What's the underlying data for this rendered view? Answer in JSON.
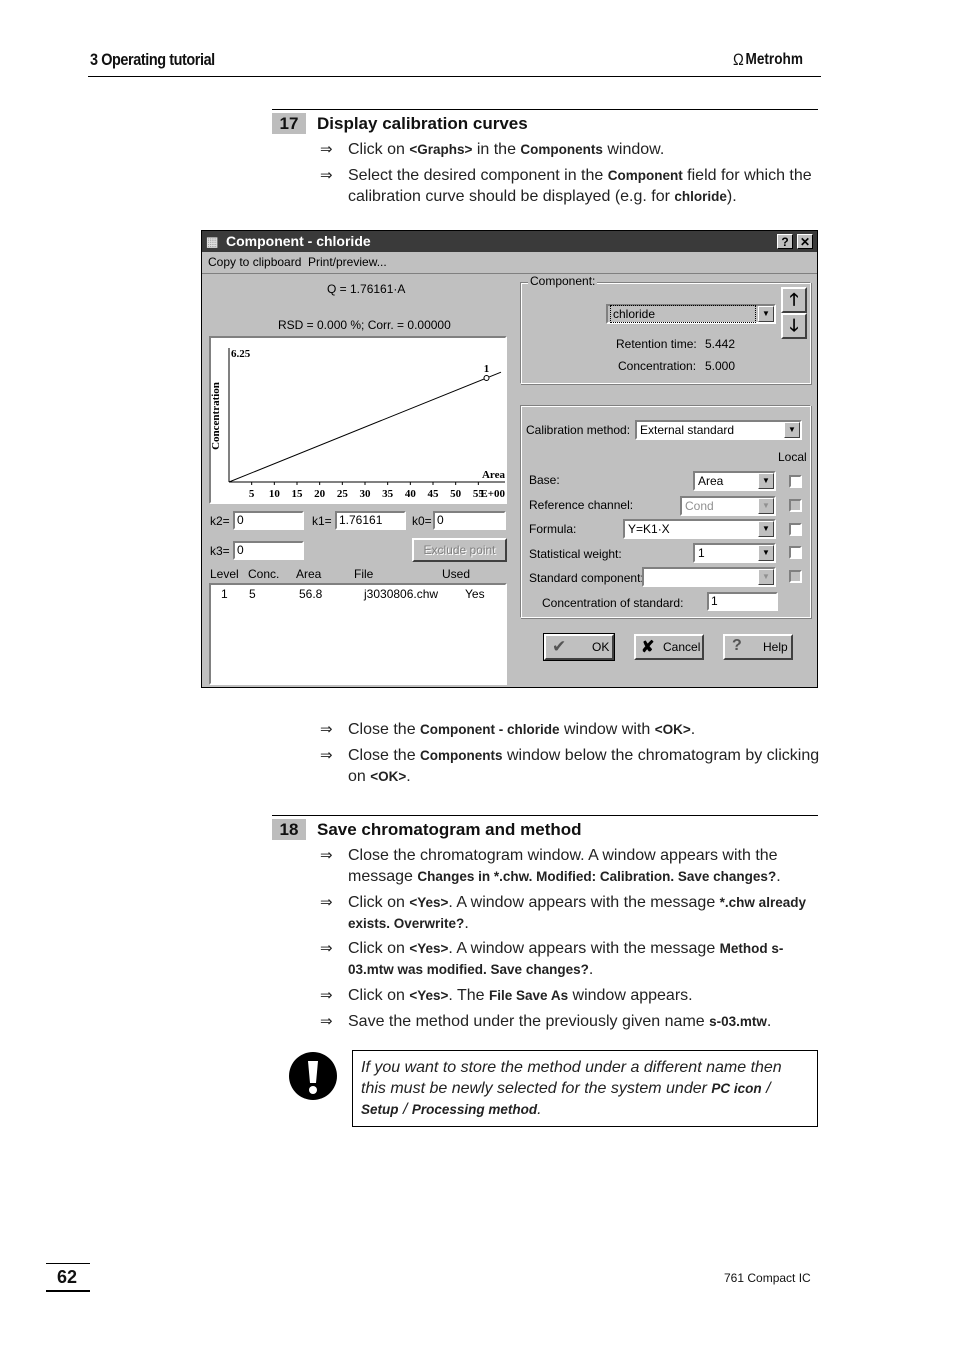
{
  "header": {
    "chapter": "3 Operating tutorial",
    "logo_text": "Metrohm",
    "logo_icon": "omega-icon"
  },
  "section17": {
    "number": "17",
    "title": "Display calibration curves",
    "bullets": [
      {
        "parts": [
          {
            "t": "Click on "
          },
          {
            "b": "<Graphs>"
          },
          {
            "t": " in the "
          },
          {
            "b": "Components"
          },
          {
            "t": " window."
          }
        ]
      },
      {
        "parts": [
          {
            "t": "Select the desired component in the "
          },
          {
            "b": "Component"
          },
          {
            "t": " field for which the calibration curve should be displayed (e.g. for "
          },
          {
            "b": "chloride"
          },
          {
            "t": ")."
          }
        ]
      }
    ]
  },
  "dialog": {
    "title": "Component - chloride",
    "help_button": "?",
    "close_button": "✕",
    "menu": [
      "Copy to clipboard",
      "Print/preview..."
    ],
    "equation": "Q = 1.76161·A",
    "stats": "RSD = 0.000 %;  Corr. = 0.00000",
    "coefficients": {
      "k2_label": "k2=",
      "k2": "0",
      "k1_label": "k1=",
      "k1": "1.76161",
      "k0_label": "k0=",
      "k0": "0",
      "k3_label": "k3=",
      "k3": "0"
    },
    "exclude_point": "Exclude point",
    "table": {
      "headers": [
        "Level",
        "Conc.",
        "Area",
        "File",
        "Used"
      ],
      "rows": [
        [
          "1",
          "5",
          "56.8",
          "j3030806.chw",
          "Yes"
        ]
      ]
    },
    "component_group": {
      "label": "Component:",
      "selected": "chloride",
      "retention_time_label": "Retention time:",
      "retention_time": "5.442",
      "concentration_label": "Concentration:",
      "concentration": "5.000",
      "up_icon": "arrow-up-icon",
      "down_icon": "arrow-down-icon"
    },
    "calibration_group": {
      "method_label": "Calibration method:",
      "method": "External standard",
      "local_label": "Local",
      "base_label": "Base:",
      "base": "Area",
      "ref_channel_label": "Reference channel:",
      "ref_channel": "Cond",
      "formula_label": "Formula:",
      "formula": "Y=K1·X",
      "weight_label": "Statistical weight:",
      "weight": "1",
      "std_component_label": "Standard component:",
      "std_component": "",
      "std_conc_label": "Concentration of standard:",
      "std_conc": "1"
    },
    "buttons": {
      "ok": "OK",
      "cancel": "Cancel",
      "help": "Help"
    }
  },
  "chart_data": {
    "type": "line",
    "title": "",
    "xlabel": "Area",
    "ylabel": "Concentration",
    "x_tick_labels": [
      "5",
      "10",
      "15",
      "20",
      "25",
      "30",
      "35",
      "40",
      "45",
      "50",
      "55"
    ],
    "x_exponent_label": "E+00",
    "y_max_label": "6.25",
    "xlim": [
      0,
      60
    ],
    "ylim": [
      0,
      6.25
    ],
    "series": [
      {
        "name": "calibration line",
        "x": [
          0,
          60
        ],
        "y": [
          0,
          5.28
        ]
      },
      {
        "name": "calibration points",
        "points": [
          {
            "label": "1",
            "x": 56.8,
            "y": 5
          }
        ]
      }
    ],
    "grid": false
  },
  "after_dialog": {
    "bullets": [
      {
        "parts": [
          {
            "t": "Close the "
          },
          {
            "b": "Component - chloride"
          },
          {
            "t": " window with "
          },
          {
            "b": "<OK>"
          },
          {
            "t": "."
          }
        ]
      },
      {
        "parts": [
          {
            "t": "Close the "
          },
          {
            "b": "Components"
          },
          {
            "t": " window below the chromatogram by clicking on "
          },
          {
            "b": "<OK>"
          },
          {
            "t": "."
          }
        ]
      }
    ]
  },
  "section18": {
    "number": "18",
    "title": "Save chromatogram and method",
    "bullets": [
      {
        "parts": [
          {
            "t": "Close the chromatogram window. A window appears with the message "
          },
          {
            "b": "Changes in *.chw. Modified: Calibration. Save changes?"
          },
          {
            "t": "."
          }
        ]
      },
      {
        "parts": [
          {
            "t": "Click on "
          },
          {
            "b": "<Yes>"
          },
          {
            "t": ". A window appears with the message "
          },
          {
            "b": "*.chw already exists. Overwrite?"
          },
          {
            "t": "."
          }
        ]
      },
      {
        "parts": [
          {
            "t": "Click on "
          },
          {
            "b": "<Yes>"
          },
          {
            "t": ". A window appears with the message "
          },
          {
            "b": "Method s-03.mtw was modified. Save changes?"
          },
          {
            "t": "."
          }
        ]
      },
      {
        "parts": [
          {
            "t": "Click on "
          },
          {
            "b": "<Yes>"
          },
          {
            "t": ". The "
          },
          {
            "b": "File Save As"
          },
          {
            "t": " window appears."
          }
        ]
      },
      {
        "parts": [
          {
            "t": "Save the method under the previously given name "
          },
          {
            "b": "s-03.mtw"
          },
          {
            "t": "."
          }
        ]
      }
    ]
  },
  "note": {
    "icon": "exclamation-icon",
    "parts": [
      {
        "t": "If you want to store the method under a different name then this must be newly selected for the system under "
      },
      {
        "b": "PC icon"
      },
      {
        "t": " / "
      },
      {
        "b": "Setup"
      },
      {
        "t": " / "
      },
      {
        "b": "Processing method"
      },
      {
        "t": "."
      }
    ]
  },
  "footer": {
    "page_number": "62",
    "product": "761 Compact IC"
  }
}
